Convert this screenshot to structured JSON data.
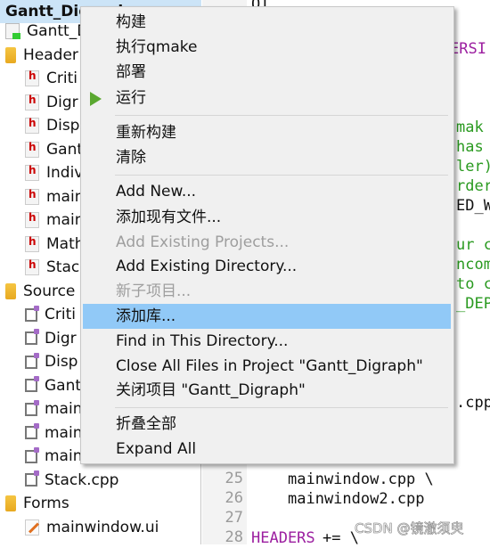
{
  "sidebar": {
    "project": "Gantt_Digraph",
    "items": [
      {
        "label": "Gantt_D",
        "icon": "qt-project-file-icon"
      },
      {
        "label": "Header",
        "icon": "headers-folder-icon"
      },
      {
        "label": "Criti",
        "icon": "header-file-icon"
      },
      {
        "label": "Digr",
        "icon": "header-file-icon"
      },
      {
        "label": "Disp",
        "icon": "header-file-icon"
      },
      {
        "label": "Gant",
        "icon": "header-file-icon"
      },
      {
        "label": "Indiv",
        "icon": "header-file-icon"
      },
      {
        "label": "main",
        "icon": "header-file-icon"
      },
      {
        "label": "main",
        "icon": "header-file-icon"
      },
      {
        "label": "Math",
        "icon": "header-file-icon"
      },
      {
        "label": "Stac",
        "icon": "header-file-icon"
      },
      {
        "label": "Source",
        "icon": "sources-folder-icon"
      },
      {
        "label": "Criti",
        "icon": "cpp-file-icon"
      },
      {
        "label": "Digr",
        "icon": "cpp-file-icon"
      },
      {
        "label": "Disp",
        "icon": "cpp-file-icon"
      },
      {
        "label": "Gant",
        "icon": "cpp-file-icon"
      },
      {
        "label": "main",
        "icon": "cpp-file-icon"
      },
      {
        "label": "main",
        "icon": "cpp-file-icon"
      },
      {
        "label": "main",
        "icon": "cpp-file-icon"
      },
      {
        "label": "Stack.cpp",
        "icon": "cpp-file-icon"
      },
      {
        "label": "Forms",
        "icon": "forms-folder-icon"
      },
      {
        "label": "mainwindow.ui",
        "icon": "ui-file-icon"
      }
    ]
  },
  "editor": {
    "line_numbers": [
      "25",
      "26",
      "27",
      "28"
    ],
    "fragments": [
      {
        "text": "QT",
        "cls": "tx"
      },
      {
        "text": "ERSI",
        "cls": "kw"
      },
      {
        "text": "mak",
        "cls": "cm"
      },
      {
        "text": "has",
        "cls": "cm"
      },
      {
        "text": "ler)",
        "cls": "cm"
      },
      {
        "text": "rder",
        "cls": "cm"
      },
      {
        "text": "ED_W",
        "cls": "tx"
      },
      {
        "text": "ur c",
        "cls": "cm"
      },
      {
        "text": "ncom",
        "cls": "cm"
      },
      {
        "text": "to c",
        "cls": "cm"
      },
      {
        "text": "_DEP",
        "cls": "cm"
      },
      {
        "text": ".cpp",
        "cls": "tx"
      },
      {
        "text": "mainwindow.cpp \\",
        "cls": "tx"
      },
      {
        "text": "mainwindow2.cpp",
        "cls": "tx"
      },
      {
        "text": "HEADERS",
        "cls": "kw"
      },
      {
        "text": "+= \\",
        "cls": "tx"
      }
    ]
  },
  "context_menu": {
    "items": [
      {
        "label": "构建"
      },
      {
        "label": "执行qmake"
      },
      {
        "label": "部署"
      },
      {
        "label": "运行",
        "icon": "run-icon"
      },
      {
        "label": "重新构建"
      },
      {
        "label": "清除"
      },
      {
        "label": "Add New..."
      },
      {
        "label": "添加现有文件..."
      },
      {
        "label": "Add Existing Projects...",
        "disabled": true
      },
      {
        "label": "Add Existing Directory..."
      },
      {
        "label": "新子项目...",
        "disabled": true
      },
      {
        "label": "添加库...",
        "highlighted": true
      },
      {
        "label": "Find in This Directory..."
      },
      {
        "label": "Close All Files in Project \"Gantt_Digraph\""
      },
      {
        "label": "关闭项目 \"Gantt_Digraph\""
      },
      {
        "label": "折叠全部"
      },
      {
        "label": "Expand All"
      }
    ]
  },
  "watermark": "CSDN @镜澈须臾",
  "colors": {
    "highlight": "#91c9f7",
    "selection": "#cce4f7",
    "run": "#5aa830",
    "keyword": "#9c1fa0",
    "comment": "#2a9a20"
  }
}
